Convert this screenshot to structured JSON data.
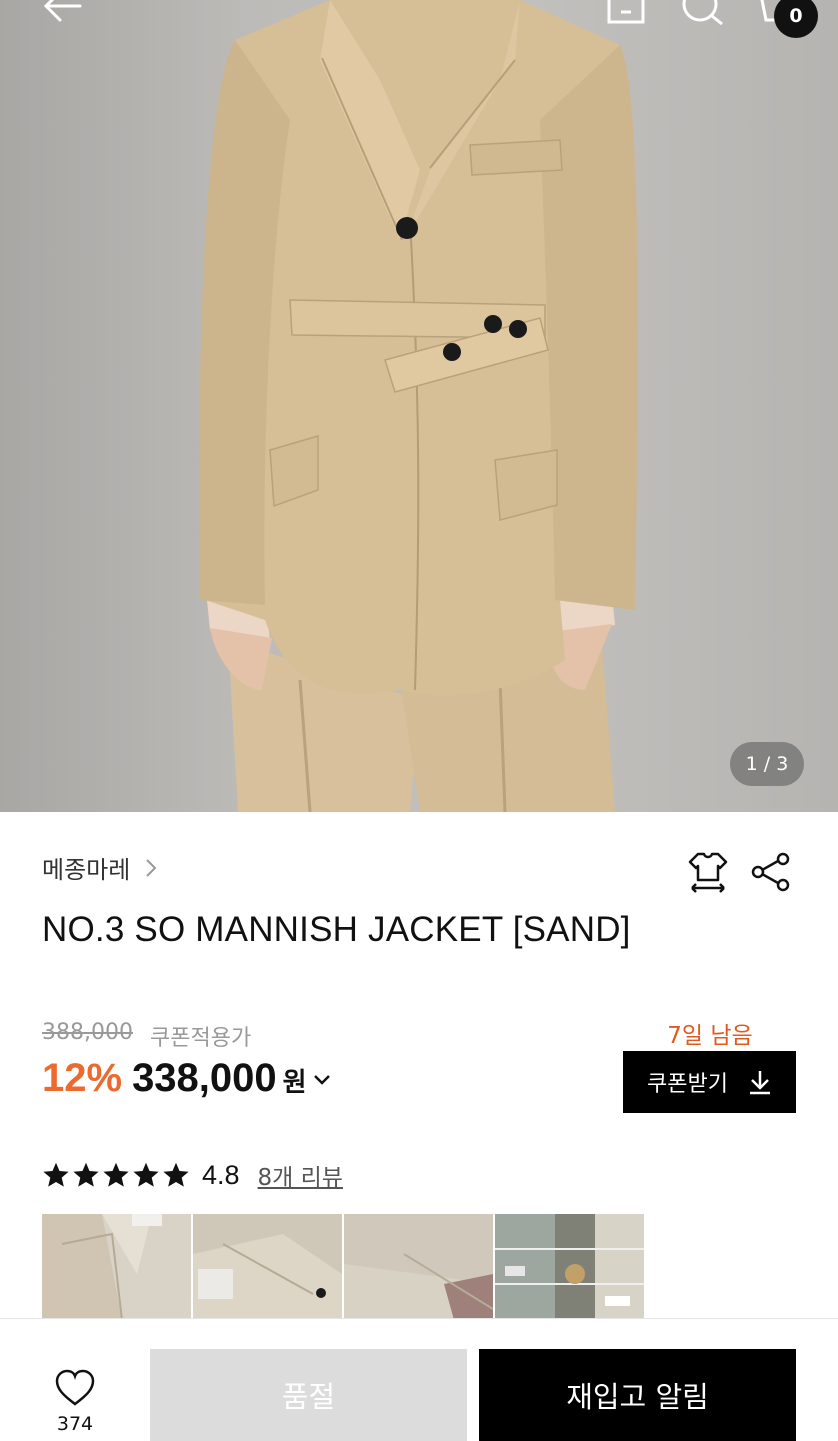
{
  "header": {
    "back_icon": "arrow-left-icon",
    "icons": [
      "home-icon",
      "search-icon",
      "cart-icon"
    ],
    "cart_count": "0"
  },
  "gallery": {
    "page_indicator": "1 / 3"
  },
  "product": {
    "brand": "메종마레",
    "title": "NO.3 SO MANNISH JACKET [SAND]",
    "original_price": "388,000",
    "coupon_price_label": "쿠폰적용가",
    "discount_rate": "12%",
    "price": "338,000",
    "currency": "원"
  },
  "coupon": {
    "days_left": "7일 남음",
    "button_label": "쿠폰받기"
  },
  "reviews": {
    "rating": "4.8",
    "rating_stars": 5,
    "review_link": "8개 리뷰"
  },
  "bottom_bar": {
    "like_count": "374",
    "soldout_label": "품절",
    "restock_label": "재입고 알림"
  },
  "colors": {
    "accent": "#ec6a2d",
    "days_left": "#e05a1f",
    "primary_button": "#000000",
    "disabled_button": "#dcdcdc"
  }
}
